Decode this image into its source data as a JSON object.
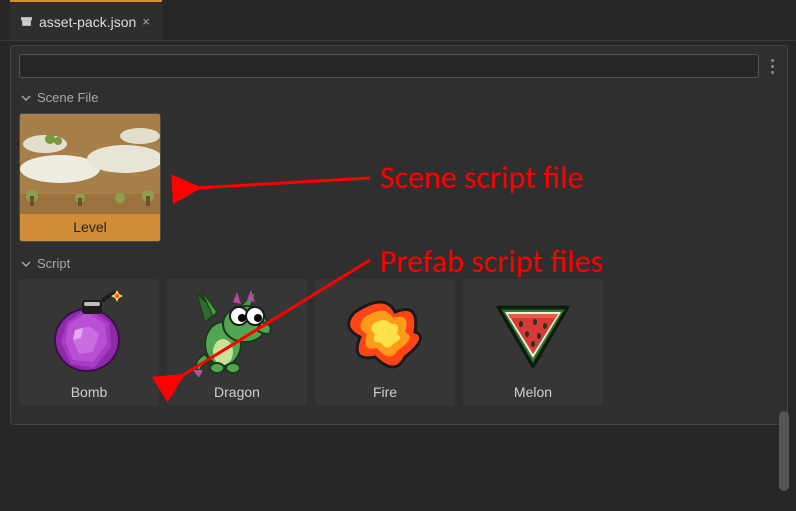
{
  "tab": {
    "title": "asset-pack.json"
  },
  "toolbar": {
    "search_placeholder": ""
  },
  "sections": {
    "sceneFile": {
      "header": "Scene File",
      "items": [
        {
          "label": "Level"
        }
      ]
    },
    "script": {
      "header": "Script",
      "items": [
        {
          "label": "Bomb"
        },
        {
          "label": "Dragon"
        },
        {
          "label": "Fire"
        },
        {
          "label": "Melon"
        }
      ]
    }
  },
  "annotations": {
    "scene_label": "Scene script file",
    "prefab_label": "Prefab script files"
  }
}
